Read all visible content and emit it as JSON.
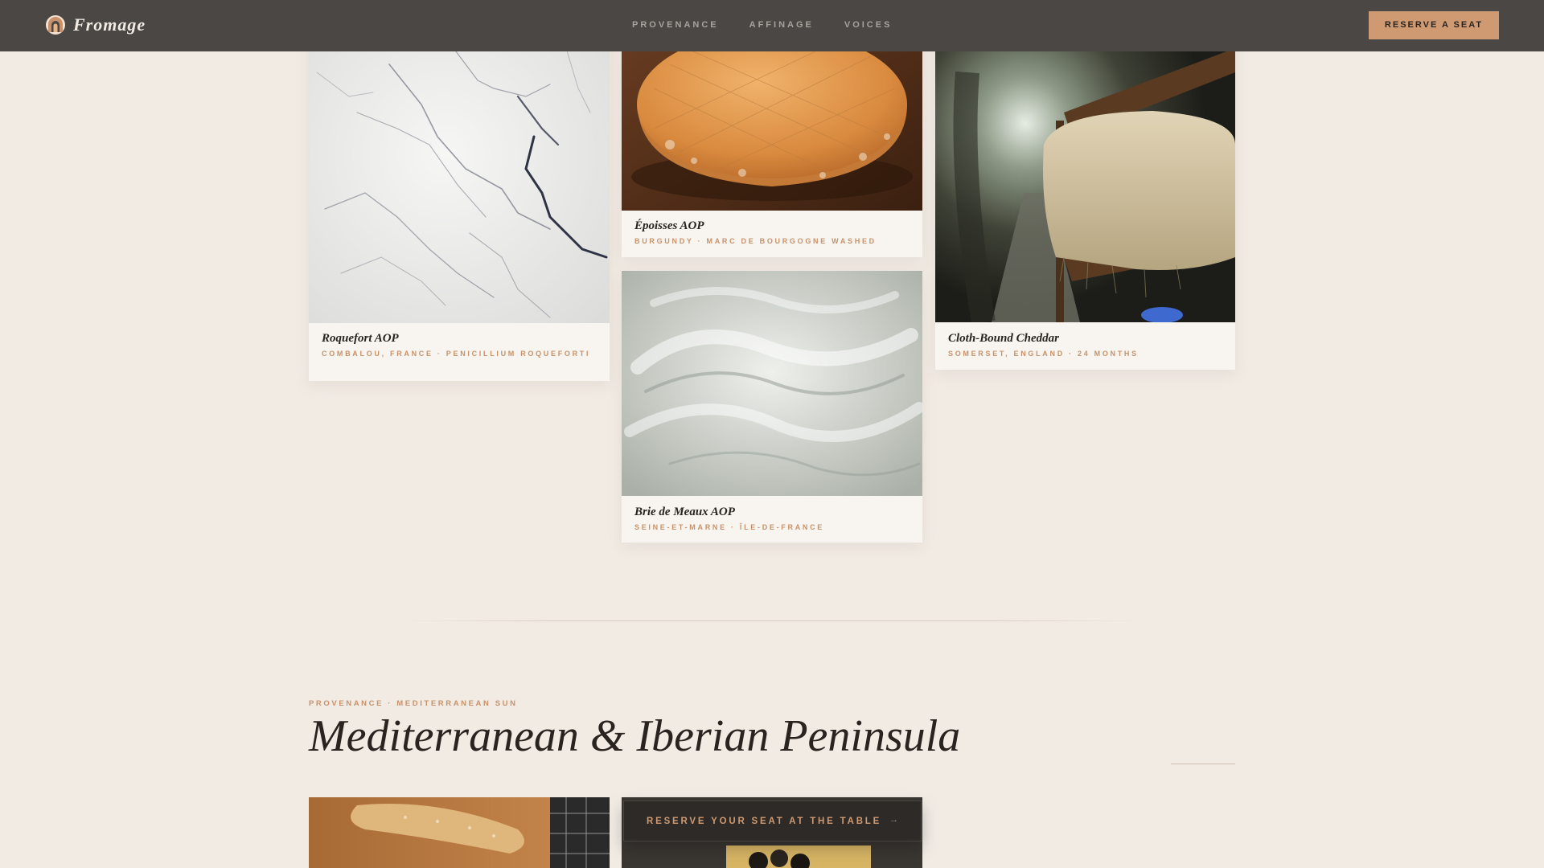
{
  "nav": {
    "brand": "Fromage",
    "brand_icon": "arch-cheese-icon",
    "links": [
      "PROVENANCE",
      "AFFINAGE",
      "VOICES"
    ],
    "cta": "RESERVE A SEAT"
  },
  "cards": {
    "roquefort": {
      "name": "Roquefort AOP",
      "meta": "COMBALOU, FRANCE · PENICILLIUM ROQUEFORTI"
    },
    "epoisses": {
      "name": "Époisses AOP",
      "meta": "BURGUNDY · MARC DE BOURGOGNE WASHED"
    },
    "cheddar": {
      "name": "Cloth-Bound Cheddar",
      "meta": "SOMERSET, ENGLAND · 24 MONTHS"
    },
    "brie": {
      "name": "Brie de Meaux AOP",
      "meta": "SEINE-ET-MARNE · ÎLE-DE-FRANCE"
    }
  },
  "section": {
    "eyebrow": "PROVENANCE · MEDITERRANEAN SUN",
    "title": "Mediterranean & Iberian Peninsula"
  },
  "floating_cta": {
    "label": "RESERVE YOUR SEAT AT THE TABLE",
    "arrow": "→"
  },
  "colors": {
    "accent": "#cf9a72",
    "nav_bg": "#4a4744",
    "page_bg": "#f1ebe4",
    "ink": "#2a2420"
  }
}
